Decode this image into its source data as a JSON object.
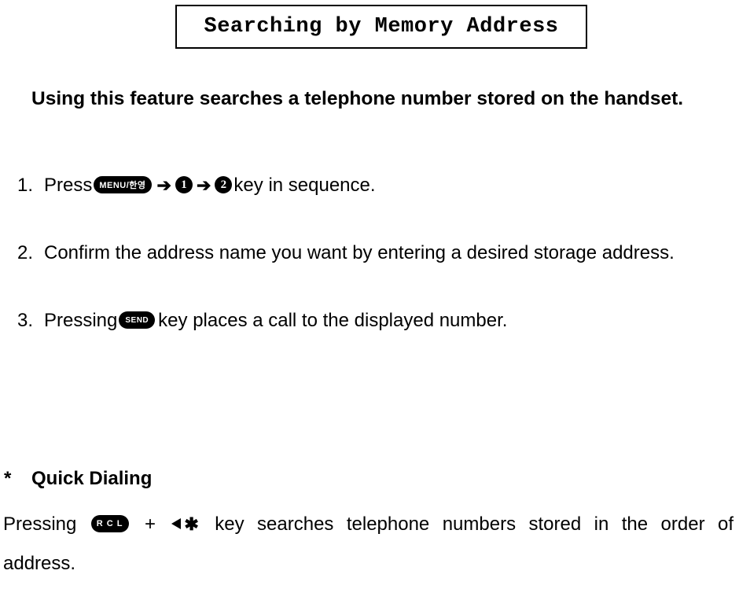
{
  "title": "Searching by Memory Address",
  "intro": "Using this feature searches a telephone number stored on the handset.",
  "steps": {
    "s1": {
      "num": "1.",
      "pre": "Press ",
      "menu_key": "MENU/한영",
      "arrow": "➔",
      "one": "1",
      "two": "2",
      "post": " key in sequence."
    },
    "s2": {
      "num": "2.",
      "text": "Confirm the address name you want by entering a desired storage address."
    },
    "s3": {
      "num": "3.",
      "pre": "Pressing ",
      "send_key": "SEND",
      "post": " key places a call to the displayed number."
    }
  },
  "quick": {
    "asterisk": "*",
    "heading": "Quick Dialing",
    "w_pressing": "Pressing",
    "rcl_key": "R C L",
    "w_plus": "+",
    "nav_star": "✱",
    "w_key": "key",
    "w_searches": "searches",
    "w_telephone": "telephone",
    "w_numbers": "numbers",
    "w_stored": "stored",
    "w_in": "in",
    "w_the": "the",
    "w_order": "order",
    "w_of": "of",
    "line2": "address."
  }
}
